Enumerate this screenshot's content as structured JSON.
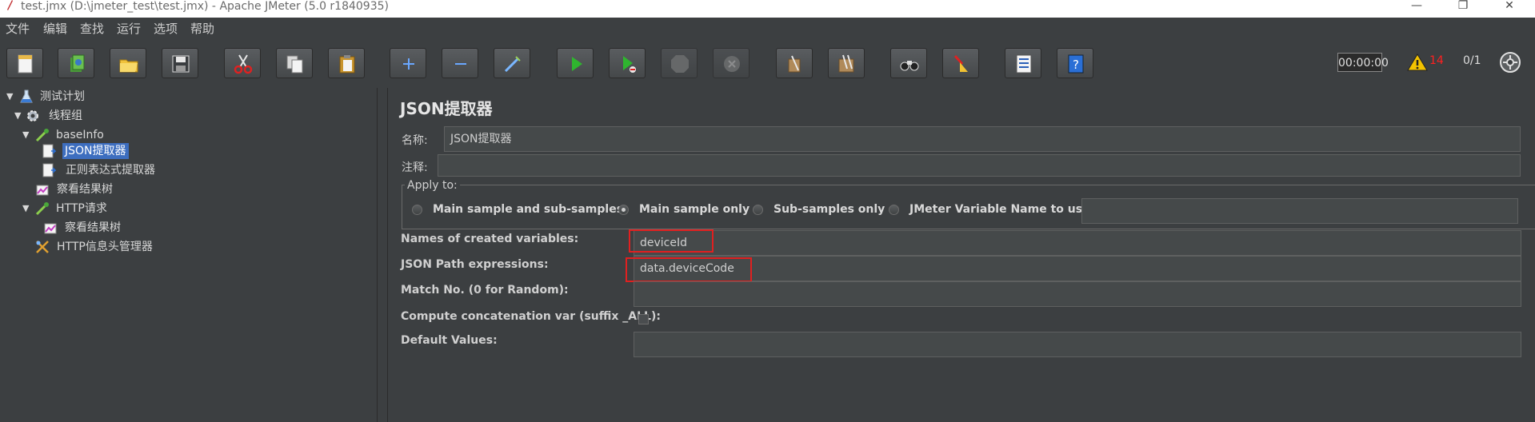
{
  "window": {
    "title": "test.jmx (D:\\jmeter_test\\test.jmx) - Apache JMeter (5.0 r1840935)",
    "minimize": "—",
    "restore": "❐",
    "close": "✕"
  },
  "menu": [
    "文件",
    "编辑",
    "查找",
    "运行",
    "选项",
    "帮助"
  ],
  "toolbar": {
    "buttons": [
      "new-icon",
      "templates-icon",
      "open-icon",
      "save-icon",
      "cut-icon",
      "copy-icon",
      "paste-icon",
      "expand-icon",
      "collapse-icon",
      "toggle-icon",
      "start-icon",
      "start-no-pause-icon",
      "stop-icon",
      "shutdown-icon",
      "clear-icon",
      "clear-all-icon",
      "search-icon",
      "reset-search-icon",
      "function-helper-icon",
      "help-icon"
    ],
    "timer": "00:00:00",
    "warning_count": "14",
    "threads": "0/1"
  },
  "tree": {
    "nodes": [
      {
        "label": "测试计划"
      },
      {
        "label": "线程组"
      },
      {
        "label": "baseInfo"
      },
      {
        "label": "JSON提取器"
      },
      {
        "label": "正则表达式提取器"
      },
      {
        "label": "察看结果树"
      },
      {
        "label": "HTTP请求"
      },
      {
        "label": "察看结果树"
      },
      {
        "label": "HTTP信息头管理器"
      }
    ]
  },
  "panel": {
    "title": "JSON提取器",
    "name_label": "名称:",
    "name_value": "JSON提取器",
    "comment_label": "注释:",
    "comment_value": "",
    "apply_to": {
      "legend": "Apply to:",
      "options": [
        "Main sample and sub-samples",
        "Main sample only",
        "Sub-samples only",
        "JMeter Variable Name to use"
      ],
      "selected": "Main sample only",
      "variable_value": ""
    },
    "names_label": "Names of created variables:",
    "names_value": "deviceId",
    "json_path_label": "JSON Path expressions:",
    "json_path_value": "data.deviceCode",
    "match_label": "Match No. (0 for Random):",
    "match_value": "",
    "concat_label": "Compute concatenation var (suffix _ALL):",
    "default_label": "Default Values:",
    "default_value": ""
  },
  "colors": {
    "background": "#3c3f41",
    "selection": "#1f3a56",
    "highlight_box": "#e02020",
    "warning": "#ff2020"
  }
}
